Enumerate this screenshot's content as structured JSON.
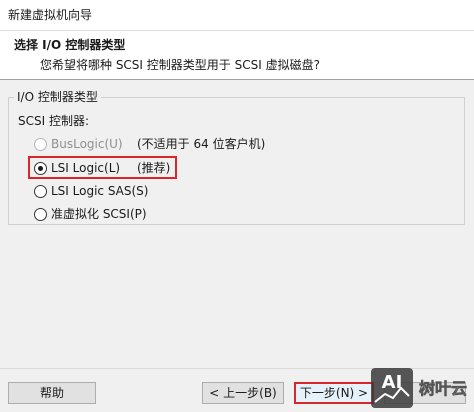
{
  "window": {
    "title": "新建虚拟机向导"
  },
  "header": {
    "title": "选择 I/O 控制器类型",
    "subtitle": "您希望将哪种 SCSI 控制器类型用于 SCSI 虚拟磁盘?"
  },
  "group": {
    "label": "I/O 控制器类型",
    "sublabel": "SCSI 控制器:",
    "options": [
      {
        "label": "BusLogic(U)",
        "note": "(不适用于 64 位客户机)",
        "checked": false,
        "disabled": true
      },
      {
        "label": "LSI Logic(L)",
        "note": "(推荐)",
        "checked": true,
        "disabled": false
      },
      {
        "label": "LSI Logic SAS(S)",
        "note": "",
        "checked": false,
        "disabled": false
      },
      {
        "label": "准虚拟化 SCSI(P)",
        "note": "",
        "checked": false,
        "disabled": false
      }
    ]
  },
  "footer": {
    "help_label": "帮助",
    "back_label": "< 上一步(B)",
    "next_label": "下一步(N) >"
  },
  "watermark": {
    "logo_text": "AI",
    "text": "树叶云"
  },
  "colors": {
    "highlight": "#d9262b",
    "content_bg": "#f0f0f0"
  }
}
